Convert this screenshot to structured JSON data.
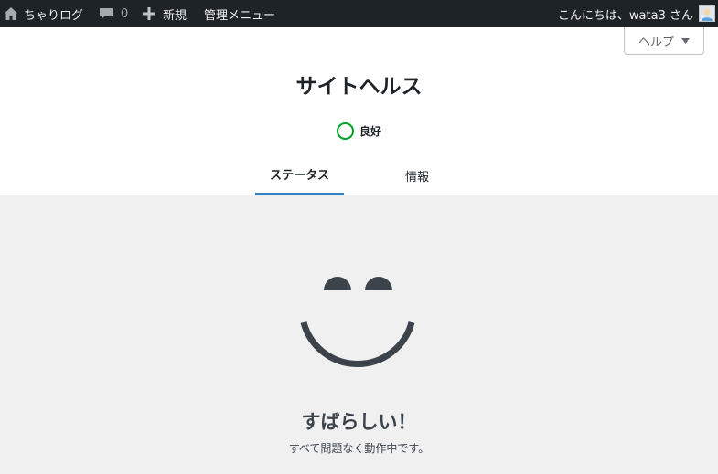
{
  "adminbar": {
    "site_name": "ちゃりログ",
    "comments_count": "0",
    "new_label": "新規",
    "admin_menu_label": "管理メニュー",
    "greeting": "こんにちは、wata3 さん"
  },
  "header": {
    "help_label": "ヘルプ",
    "title": "サイトヘルス",
    "status_label": "良好",
    "tabs": [
      {
        "label": "ステータス",
        "active": true
      },
      {
        "label": "情報",
        "active": false
      }
    ]
  },
  "main": {
    "headline": "すばらしい！",
    "subline": "すべて問題なく動作中です。"
  },
  "colors": {
    "adminbar_bg": "#1d2327",
    "accent": "#3582c4",
    "good": "#00a32a"
  }
}
